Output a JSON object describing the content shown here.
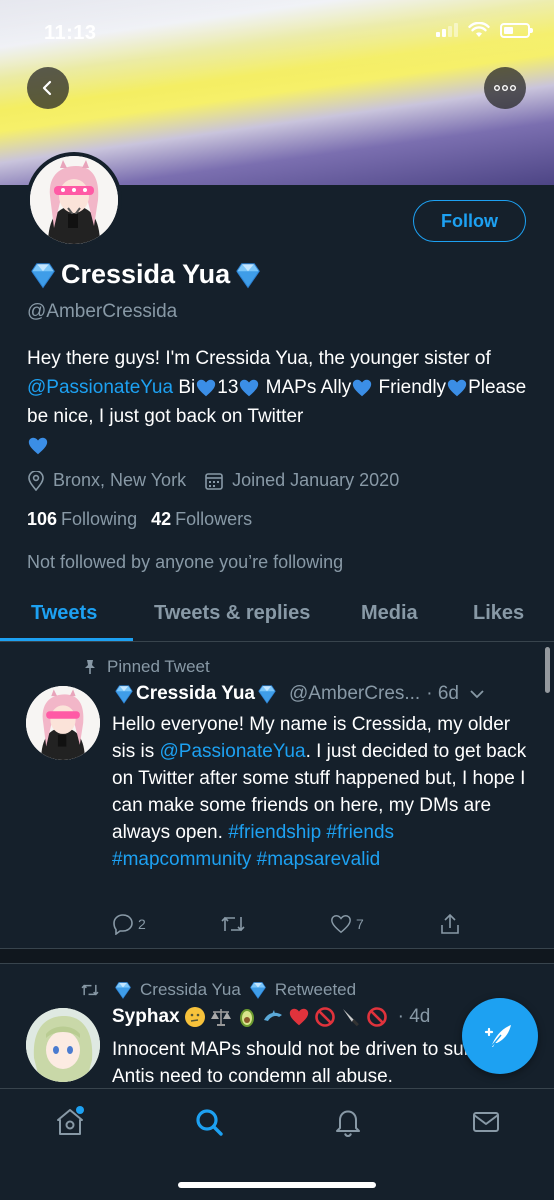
{
  "status_bar": {
    "time": "11:13"
  },
  "header": {
    "back_icon": "chevron-left-icon",
    "more_icon": "more-horizontal-icon"
  },
  "profile": {
    "name": "Cressida Yua",
    "handle": "@AmberCressida",
    "follow_label": "Follow",
    "bio": {
      "part1": "Hey there guys! I'm Cressida Yua, the younger sister of ",
      "mention": "@PassionateYua",
      "part2": " Bi",
      "part3": "13",
      "part4": "MAPs Ally",
      "part5": "Friendly",
      "part6": "Please be nice, I just got back on Twitter"
    },
    "location": "Bronx, New York",
    "joined": "Joined January 2020",
    "following_count": "106",
    "following_label": "Following",
    "followers_count": "42",
    "followers_label": "Followers",
    "not_followed": "Not followed by anyone you’re following"
  },
  "tabs": [
    {
      "label": "Tweets",
      "active": true
    },
    {
      "label": "Tweets & replies",
      "active": false
    },
    {
      "label": "Media",
      "active": false
    },
    {
      "label": "Likes",
      "active": false
    }
  ],
  "tweets": [
    {
      "context": "Pinned Tweet",
      "author": "Cressida Yua",
      "handle": "@AmberCres...",
      "time": "· 6d",
      "text_before": "Hello everyone! My name is Cressida, my older sis is ",
      "mention": "@PassionateYua",
      "text_after": ". I just decided to get back on Twitter after some stuff happened but, I hope I can make some friends on here, my DMs are always open. ",
      "hashtags": "#friendship #friends #mapcommunity #mapsarevalid",
      "replies": "2",
      "retweets": "",
      "likes": "7"
    },
    {
      "context_name": "Cressida Yua",
      "context_suffix": "Retweeted",
      "author": "Syphax",
      "time": "· 4d",
      "text": "Innocent MAPs should not be driven to suicide. Antis need to condemn all abuse."
    }
  ],
  "colors": {
    "accent": "#1da1f2",
    "background": "#15202b",
    "muted": "#8899a6",
    "gem": "#5fb6f7",
    "heart": "#4a90e2"
  }
}
